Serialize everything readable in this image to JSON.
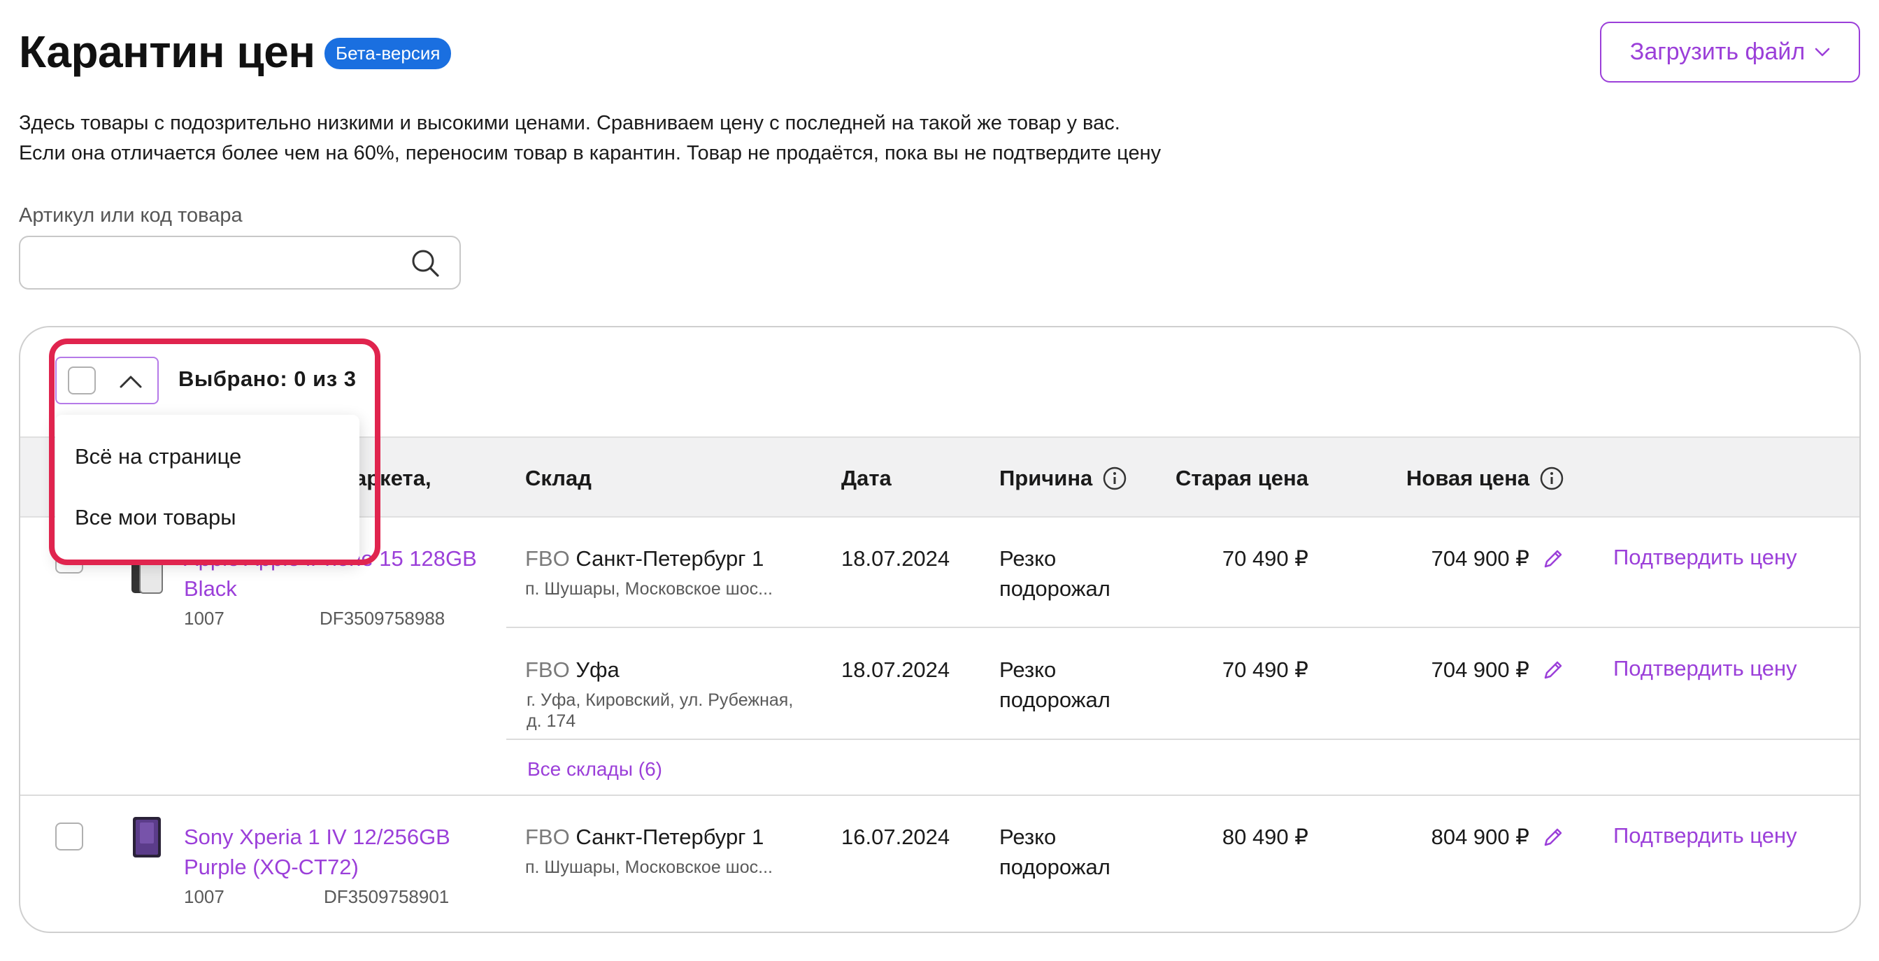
{
  "header": {
    "title": "Карантин цен",
    "badge": "Бета-версия",
    "upload_button": "Загрузить файл"
  },
  "description": {
    "line1": "Здесь товары с подозрительно низкими и высокими ценами. Сравниваем цену с последней на такой же товар у вас.",
    "line2": "Если она отличается более чем на 60%, переносим товар в карантин. Товар не продаётся, пока вы не подтвердите цену"
  },
  "search": {
    "label": "Артикул или код товара",
    "value": "",
    "placeholder": ""
  },
  "selection": {
    "count_text": "Выбрано: 0 из 3",
    "dropdown_items": [
      "Всё на странице",
      "Все мои товары"
    ]
  },
  "table": {
    "columns": {
      "product_partial": "аркета,",
      "warehouse": "Склад",
      "date": "Дата",
      "reason": "Причина",
      "old_price": "Старая цена",
      "new_price": "Новая цена"
    },
    "rows": [
      {
        "product_name_line1": "Apple Apple iPhone 15 128GB",
        "product_name_line2": "Black",
        "sku": "1007",
        "code": "DF3509758988",
        "warehouses": [
          {
            "type": "FBO",
            "name": "Санкт-Петербург 1",
            "address": "п. Шушары, Московское шос...",
            "date": "18.07.2024",
            "reason_line1": "Резко",
            "reason_line2": "подорожал",
            "old_price": "70 490 ₽",
            "new_price": "704 900 ₽",
            "action": "Подтвердить цену"
          },
          {
            "type": "FBO",
            "name": "Уфа",
            "address_line1": "г. Уфа, Кировский, ул. Рубежная,",
            "address_line2": "д. 174",
            "date": "18.07.2024",
            "reason_line1": "Резко",
            "reason_line2": "подорожал",
            "old_price": "70 490 ₽",
            "new_price": "704 900 ₽",
            "action": "Подтвердить цену"
          }
        ],
        "all_warehouses_link": "Все склады (6)"
      },
      {
        "product_name_line1": "Sony Xperia 1 IV 12/256GB",
        "product_name_line2": "Purple (XQ-CT72)",
        "sku": "1007",
        "code": "DF3509758901",
        "warehouses": [
          {
            "type": "FBO",
            "name": "Санкт-Петербург 1",
            "address": "п. Шушары, Московское шос...",
            "date": "16.07.2024",
            "reason_line1": "Резко",
            "reason_line2": "подорожал",
            "old_price": "80 490 ₽",
            "new_price": "804 900 ₽",
            "action": "Подтвердить цену"
          }
        ]
      }
    ]
  },
  "colors": {
    "accent": "#9b3fd9",
    "badge": "#1a6fe0",
    "highlight": "#e0244e"
  },
  "icons": [
    "chevron-down-icon",
    "search-icon",
    "chevron-up-icon",
    "info-icon",
    "pencil-icon"
  ]
}
